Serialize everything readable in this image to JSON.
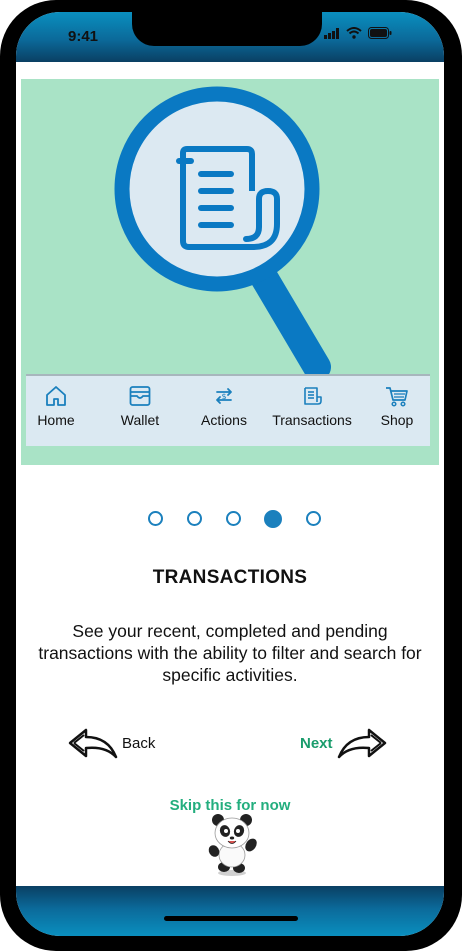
{
  "status": {
    "time": "9:41"
  },
  "tabbar": {
    "items": [
      {
        "label": "Home",
        "icon": "home-icon"
      },
      {
        "label": "Wallet",
        "icon": "wallet-icon"
      },
      {
        "label": "Actions",
        "icon": "exchange-icon"
      },
      {
        "label": "Transactions",
        "icon": "receipt-icon"
      },
      {
        "label": "Shop",
        "icon": "cart-icon"
      }
    ]
  },
  "onboarding": {
    "step_total": 5,
    "step_active": 4,
    "title": "TRANSACTIONS",
    "description": "See your recent, completed and pending transactions with the ability to filter and search for specific activities."
  },
  "nav": {
    "back_label": "Back",
    "next_label": "Next",
    "skip_label": "Skip this for now"
  },
  "colors": {
    "accent": "#1b80bd",
    "hero_bg": "#a9e3c6",
    "next_green": "#1a9c6c"
  }
}
